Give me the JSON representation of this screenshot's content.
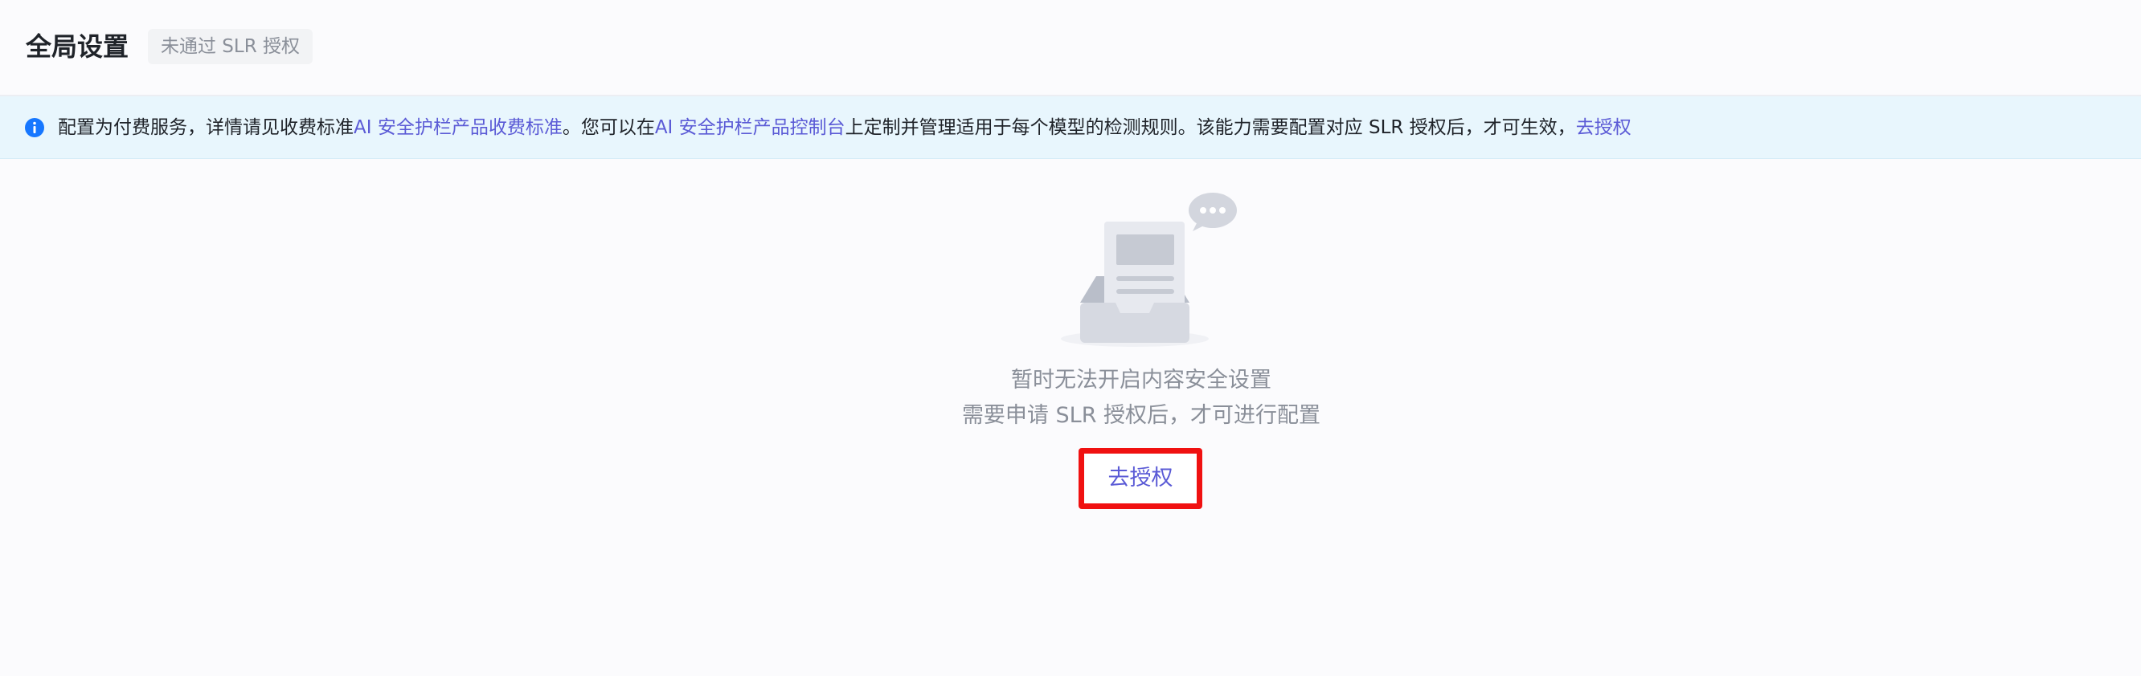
{
  "header": {
    "title": "全局设置",
    "badge": "未通过 SLR 授权"
  },
  "banner": {
    "icon": "info-icon",
    "text_part1": "配置为付费服务，详情请见收费标准",
    "link1": "AI 安全护栏产品收费标准",
    "text_part2": "。您可以在",
    "link2": "AI 安全护栏产品控制台",
    "text_part3": "上定制并管理适用于每个模型的检测规则。该能力需要配置对应 SLR 授权后，才可生效，",
    "link3": "去授权"
  },
  "empty_state": {
    "icon": "empty-inbox-illustration",
    "title": "暂时无法开启内容安全设置",
    "subtitle": "需要申请 SLR 授权后，才可进行配置",
    "button_label": "去授权"
  },
  "colors": {
    "accent": "#5b5bd6",
    "banner_bg": "#e8f6fd",
    "info_icon": "#1677ff",
    "highlight_border": "#f01111"
  }
}
